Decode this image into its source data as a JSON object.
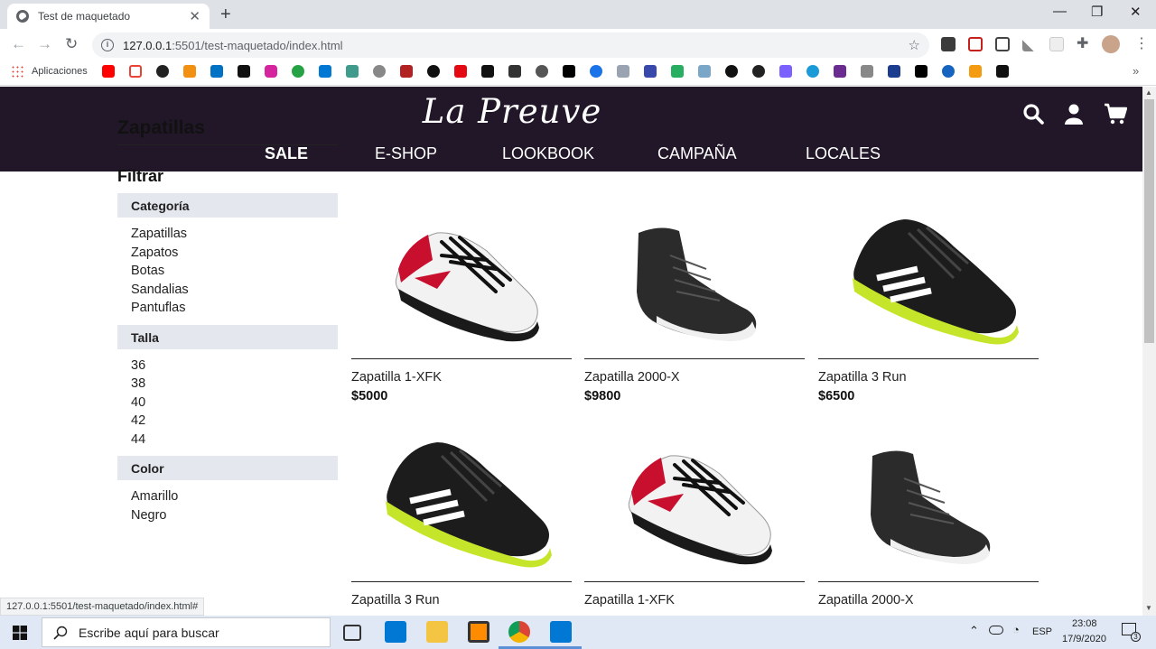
{
  "browser": {
    "tab_title": "Test de maquetado",
    "tab_close": "✕",
    "new_tab": "+",
    "window": {
      "minimize": "—",
      "restore": "❐",
      "close": "✕"
    },
    "url_host": "127.0.0.1",
    "url_path": ":5501/test-maquetado/index.html",
    "bookmarks_apps_label": "Aplicaciones",
    "bookmarks_more": "»",
    "status_url": "127.0.0.1:5501/test-maquetado/index.html#"
  },
  "site": {
    "logo": "La Preuve",
    "nav": [
      "SALE",
      "E-SHOP",
      "LOOKBOOK",
      "CAMPAÑA",
      "LOCALES"
    ],
    "icons": [
      "search-icon",
      "user-icon",
      "cart-icon"
    ]
  },
  "sidebar": {
    "title": "Zapatillas",
    "filter_title": "Filtrar",
    "categories": {
      "label": "Categoría",
      "items": [
        "Zapatillas",
        "Zapatos",
        "Botas",
        "Sandalias",
        "Pantuflas"
      ]
    },
    "sizes": {
      "label": "Talla",
      "items": [
        "36",
        "38",
        "40",
        "42",
        "44"
      ]
    },
    "colors": {
      "label": "Color",
      "items": [
        "Amarillo",
        "Negro"
      ]
    }
  },
  "products": [
    {
      "name": "Zapatilla 1-XFK",
      "price": "$5000"
    },
    {
      "name": "Zapatilla 2000-X",
      "price": "$9800"
    },
    {
      "name": "Zapatilla 3 Run",
      "price": "$6500"
    },
    {
      "name": "Zapatilla 3 Run",
      "price": ""
    },
    {
      "name": "Zapatilla 1-XFK",
      "price": ""
    },
    {
      "name": "Zapatilla 2000-X",
      "price": ""
    }
  ],
  "taskbar": {
    "search_placeholder": "Escribe aquí para buscar",
    "language": "ESP",
    "time": "23:08",
    "date": "17/9/2020",
    "notifications": "3"
  },
  "colors": {
    "header_bg": "#221728",
    "filter_bg": "#e4e7ee"
  }
}
